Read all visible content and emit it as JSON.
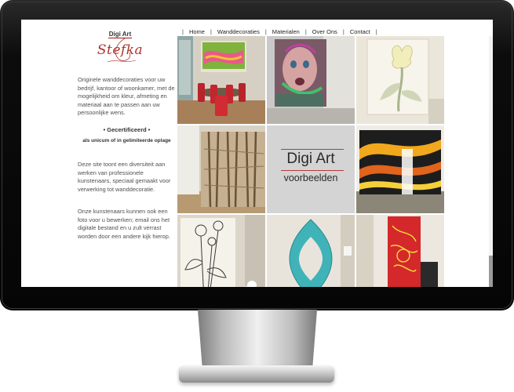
{
  "logo": {
    "brand": "Digi Art",
    "script": "Stefka"
  },
  "nav": {
    "items": [
      "Home",
      "Wanddecoraties",
      "Materialen",
      "Over Ons",
      "Contact"
    ]
  },
  "intro": "Originele wanddecoraties voor uw bedrijf, kantoor of woonkamer, met de mogelijkheid om kleur, afmeting en materiaal aan te passen aan uw persoonlijke wens.",
  "certified": "• Gecertificeerd •",
  "certified_sub": "als unicum of in gelimiteerde oplage",
  "para2": "Deze site toont een diversiteit aan werken van professionele kunstenaars, speciaal gemaakt voor verwerking tot wanddecoratie.",
  "para3": "Onze kunstenaars kunnen ook een foto voor u bewerken; email ons het digitale bestand en u zult verrast worden door een andere kijk hierop.",
  "center_tile": {
    "title": "Digi Art",
    "subtitle": "voorbeelden"
  },
  "tiles": [
    {
      "name": "tile-dining-room-art",
      "caption": ""
    },
    {
      "name": "tile-face-art",
      "caption": ""
    },
    {
      "name": "tile-flower-relief",
      "caption": ""
    },
    {
      "name": "tile-forest-mural",
      "caption": ""
    },
    {
      "name": "tile-digi-art-voorbeelden",
      "caption": ""
    },
    {
      "name": "tile-abstract-stripes",
      "caption": ""
    },
    {
      "name": "tile-flower-sketch",
      "caption": ""
    },
    {
      "name": "tile-turquoise-shape",
      "caption": ""
    },
    {
      "name": "tile-red-yellow-panel",
      "caption": ""
    }
  ],
  "colors": {
    "logo_red": "#b0302a",
    "text": "#505050",
    "monitor": "#0a0a0a"
  }
}
